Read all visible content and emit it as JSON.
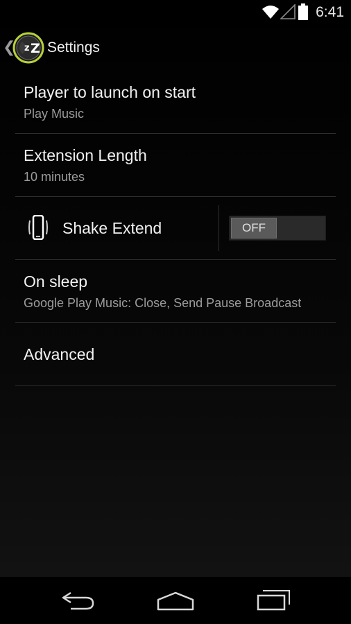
{
  "status_bar": {
    "time": "6:41",
    "icons": [
      "wifi-icon",
      "cell-signal-icon",
      "battery-icon"
    ]
  },
  "action_bar": {
    "back_icon": "chevron-left-icon",
    "app_icon": "app-logo-icon",
    "title": "Settings"
  },
  "settings": [
    {
      "title": "Player to launch on start",
      "summary": "Play Music"
    },
    {
      "title": "Extension Length",
      "summary": "10 minutes"
    },
    {
      "title": "Shake Extend",
      "icon": "phone-shake-icon",
      "toggle_label": "OFF",
      "toggle_state": "off"
    },
    {
      "title": "On sleep",
      "summary": "Google Play Music: Close, Send Pause Broadcast"
    },
    {
      "title": "Advanced"
    }
  ],
  "nav_bar": {
    "icons": [
      "back-icon",
      "home-icon",
      "recents-icon"
    ]
  },
  "colors": {
    "background": "#000000",
    "title_text": "#f2f2f2",
    "summary_text": "#9c9c9c",
    "divider": "#2e2e2e",
    "app_icon_accent": "#b6d13a"
  }
}
